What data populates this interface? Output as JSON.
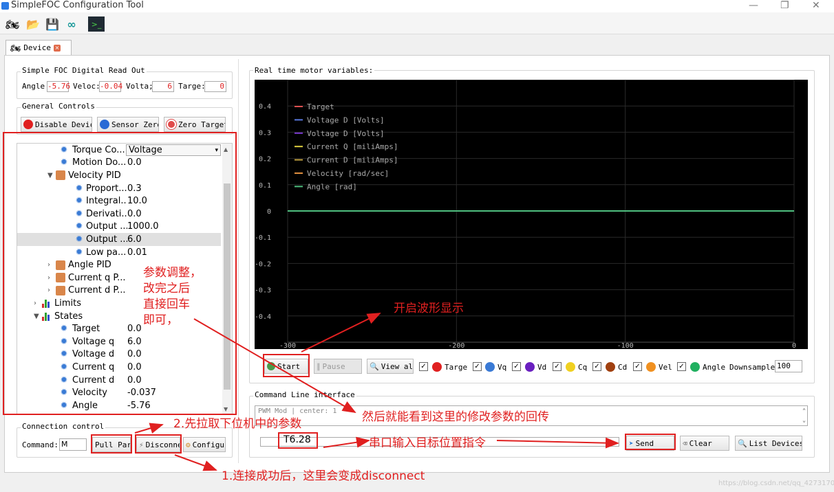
{
  "window": {
    "title": "SimpleFOC Configuration Tool"
  },
  "toolbar": {
    "icons": [
      "add-device-icon",
      "open-folder-icon",
      "save-icon",
      "arduino-icon",
      "terminal-icon"
    ]
  },
  "tab": {
    "label": "Device"
  },
  "readout": {
    "title": "Simple FOC Digital Read Out",
    "fields": [
      {
        "label": "Angle",
        "value": "-5.76"
      },
      {
        "label": "Veloc:",
        "value": "-0.04"
      },
      {
        "label": "Volta;",
        "value": "6"
      },
      {
        "label": "Targe:",
        "value": "0"
      }
    ]
  },
  "general_controls": {
    "title": "General Controls",
    "disable_label": "Disable Device",
    "sensor_zero_label": "Sensor Zero",
    "zero_target_label": "Zero Target"
  },
  "tree": {
    "rows": [
      {
        "label": "Torque Co...",
        "value": "Voltage"
      },
      {
        "label": "Motion Do...",
        "value": "0.0"
      },
      {
        "label": "Velocity PID",
        "value": ""
      },
      {
        "label": "Proport...",
        "value": "0.3"
      },
      {
        "label": "Integral...",
        "value": "10.0"
      },
      {
        "label": "Derivati...",
        "value": "0.0"
      },
      {
        "label": "Output ...",
        "value": "1000.0"
      },
      {
        "label": "Output ...",
        "value": "6.0"
      },
      {
        "label": "Low pa...",
        "value": "0.01"
      },
      {
        "label": "Angle PID",
        "value": ""
      },
      {
        "label": "Current q P...",
        "value": ""
      },
      {
        "label": "Current d P...",
        "value": ""
      },
      {
        "label": "Limits",
        "value": ""
      },
      {
        "label": "States",
        "value": ""
      },
      {
        "label": "Target",
        "value": "0.0"
      },
      {
        "label": "Voltage q",
        "value": "6.0"
      },
      {
        "label": "Voltage d",
        "value": "0.0"
      },
      {
        "label": "Current q",
        "value": "0.0"
      },
      {
        "label": "Current d",
        "value": "0.0"
      },
      {
        "label": "Velocity",
        "value": "-0.037"
      },
      {
        "label": "Angle",
        "value": "-5.76"
      }
    ]
  },
  "connection": {
    "title": "Connection control",
    "command_label": "Command:",
    "command_value": "M",
    "pull_label": "Pull Params",
    "disconnect_label": "Disconnect",
    "configure_label": "Configure"
  },
  "plot": {
    "title": "Real time motor variables:",
    "legend": [
      "Target",
      "Voltage D [Volts]",
      "Voltage D [Volts]",
      "Current Q [miliAmps]",
      "Current D [miliAmps]",
      "Velocity [rad/sec]",
      "Angle [rad]"
    ],
    "controls": {
      "start_label": "Start",
      "pause_label": "Pause",
      "view_all_label": "View all",
      "checks": [
        "Target",
        "Vq",
        "Vd",
        "Cq",
        "Cd",
        "Vel",
        "Angle"
      ],
      "downsample_label": "Downsample",
      "downsample_value": "100"
    }
  },
  "chart_data": {
    "type": "line",
    "title": "",
    "xlabel": "",
    "ylabel": "",
    "xlim": [
      -300,
      0
    ],
    "ylim": [
      -0.5,
      0.5
    ],
    "x_ticks": [
      "-300",
      "-200",
      "-100",
      "0"
    ],
    "y_ticks": [
      "0.4",
      "0.3",
      "0.2",
      "0.1",
      "0",
      "-0.1",
      "-0.2",
      "-0.3",
      "-0.4"
    ],
    "grid": true,
    "legend_position": "top-left",
    "series": [
      {
        "name": "Angle [rad]",
        "x": [
          -300,
          0
        ],
        "values": [
          0,
          0
        ]
      }
    ],
    "colors": [
      "#e05050",
      "#5a7ae0",
      "#7a3ad0",
      "#e0d040",
      "#c0a040",
      "#e09040",
      "#50c080"
    ]
  },
  "command_line": {
    "title": "Command Line interface",
    "output_text": "PWM Mod | center: 1",
    "input_value": "T6.28",
    "send_label": "Send",
    "clear_label": "Clear",
    "list_label": "List Devices"
  },
  "annotations": {
    "tune_params": "参数调整，\n改完之后\n直接回车\n即可，",
    "start_wave": "开启波形显示",
    "see_echo": "然后就能看到这里的修改参数的回传",
    "pull_first": "2.先拉取下位机中的参数",
    "serial_input": "串口输入目标位置指令",
    "after_connect": "1.连接成功后，这里会变成disconnect"
  },
  "watermark": "https://blog.csdn.net/qq_42731705"
}
